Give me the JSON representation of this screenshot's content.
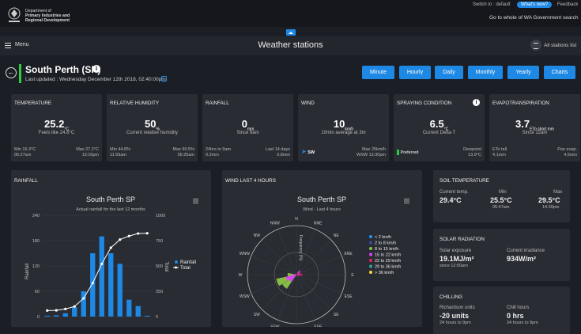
{
  "header": {
    "dept_lines": [
      "Department of",
      "Primary Industries and",
      "Regional Development"
    ],
    "dept_tagline": "GOVERNMENT OF WESTERN AUSTRALIA",
    "switch_to": "Switch to : default",
    "whats_new": "What's new?",
    "feedback": "Feedback",
    "go_to_wa": "Go to whole of WA Government search"
  },
  "nav": {
    "menu_label": "Menu",
    "title": "Weather stations",
    "all_stations": "All stations list"
  },
  "station": {
    "name": "South Perth (SP)",
    "last_updated": "Last updated : Wednesday December 12th 2018, 02:40:00pm",
    "accent_color": "#2ecc40"
  },
  "period_buttons": [
    "Minute",
    "Hourly",
    "Daily",
    "Monthly",
    "Yearly",
    "Charts"
  ],
  "cards": {
    "temperature": {
      "title": "TEMPERATURE",
      "value": "25.2",
      "unit": "°C",
      "sub": "Feels like 24.8°C",
      "foot_left": [
        "Min 16.3°C",
        "05:27am"
      ],
      "foot_right": [
        "Max 27.2°C",
        "13:16pm"
      ]
    },
    "humidity": {
      "title": "RELATIVE HUMIDITY",
      "value": "50",
      "unit": "%",
      "sub": "Current relative humidity",
      "foot_left": [
        "Min 44.8%",
        "11:59am"
      ],
      "foot_right": [
        "Max 90.5%",
        "05:25am"
      ]
    },
    "rainfall": {
      "title": "RAINFALL",
      "value": "0",
      "unit": "mm",
      "sub": "Since 9am",
      "foot_left": [
        "24hrs to 9am",
        "0.2mm"
      ],
      "foot_right": [
        "Last 14 days",
        "0.8mm"
      ]
    },
    "wind": {
      "title": "WIND",
      "value": "10",
      "unit": "km/h",
      "sub": "10min average at 3m",
      "dir": "SW",
      "foot_right": [
        "Max 25km/h",
        "WSW 13:30pm"
      ]
    },
    "spraying": {
      "title": "SPRAYING CONDITION",
      "value": "6.5",
      "unit": "°C",
      "sub": "Current Delta-T",
      "status": "Preferred",
      "status_color": "#2ecc40",
      "foot_right": [
        "Dewpoint",
        "13.9°C"
      ]
    },
    "evapo": {
      "title": "EVAPOTRANSPIRATION",
      "value": "3.7",
      "unit": "ETo short mm",
      "sub": "Since 12am",
      "foot_left": [
        "ETo tall",
        "4.1mm"
      ],
      "foot_right": [
        "Pan evap.",
        "4.5mm"
      ]
    }
  },
  "rainfall_panel": {
    "panel_title": "RAINFALL",
    "chart_title": "South Perth SP",
    "chart_subtitle": "Actual rainfall for the last 12 months",
    "left_ticks": [
      "0",
      "60",
      "120",
      "180",
      "240"
    ],
    "right_ticks": [
      "0",
      "250",
      "500",
      "750",
      "1000"
    ],
    "ylabel_left": "Rainfall",
    "ylabel_right": "Total",
    "legend": [
      "Rainfall",
      "Total"
    ]
  },
  "wind_panel": {
    "panel_title": "WIND LAST 4 HOURS",
    "chart_title": "South Perth SP",
    "chart_subtitle": "Wind - Last 4 hours",
    "compass": [
      "N",
      "NNE",
      "NE",
      "ENE",
      "E",
      "ESE",
      "SE",
      "SSE",
      "S",
      "SSW",
      "SW",
      "WSW",
      "W",
      "WNW",
      "NW",
      "NNW"
    ],
    "radial_label": "Frequency (%)",
    "legend": [
      {
        "label": "< 2 km/h",
        "color": "#2196f3"
      },
      {
        "label": "2 to 8 km/h",
        "color": "#3949ab"
      },
      {
        "label": "8 to 15 km/h",
        "color": "#8bc34a"
      },
      {
        "label": "15 to 22 km/h",
        "color": "#e040fb"
      },
      {
        "label": "22 to 29 km/h",
        "color": "#e91e63"
      },
      {
        "label": "29 to 36 km/h",
        "color": "#26a69a"
      },
      {
        "label": "> 36 km/h",
        "color": "#fdd835"
      }
    ]
  },
  "soil": {
    "title": "SOIL TEMPERATURE",
    "current_label": "Current temp.",
    "current": "29.4°C",
    "min_label": "Min",
    "min": "25.5°C",
    "min_time": "05:47am",
    "max_label": "Max",
    "max": "29.5°C",
    "max_time": "14:39pm"
  },
  "solar": {
    "title": "SOLAR RADIATION",
    "exposure_label": "Solar exposure",
    "exposure": "19.1MJ/m²",
    "exposure_sub": "since 12:00am",
    "irradiance_label": "Current irradiance",
    "irradiance": "934W/m²"
  },
  "chilling": {
    "title": "CHILLING",
    "richardson_label": "Richardson units",
    "richardson": "-20 units",
    "richardson_sub": "24 hours to 9pm",
    "chill_label": "Chill hours",
    "chill": "0 hrs",
    "chill_sub": "24 hours to 9pm"
  },
  "chart_data": [
    {
      "type": "bar",
      "title": "South Perth SP",
      "subtitle": "Actual rainfall for the last 12 months",
      "ylabel": "Rainfall",
      "ylim": [
        0,
        240
      ],
      "y2label": "Total",
      "y2lim": [
        0,
        1000
      ],
      "values": [
        2,
        3,
        8,
        22,
        60,
        150,
        190,
        150,
        125,
        40,
        25,
        2
      ],
      "totals": [
        60,
        62,
        75,
        100,
        180,
        330,
        520,
        680,
        760,
        795,
        820,
        822
      ],
      "legend": [
        "Rainfall",
        "Total"
      ]
    }
  ]
}
